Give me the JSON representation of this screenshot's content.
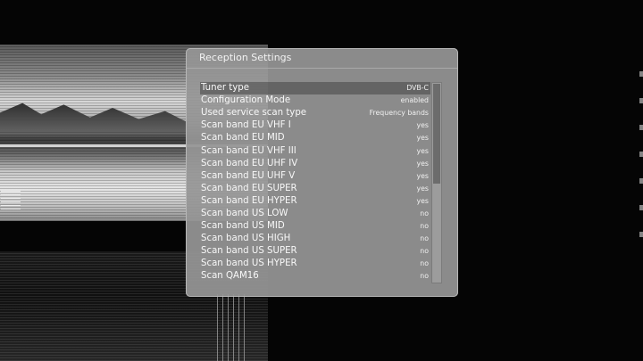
{
  "dialog": {
    "title": "Reception Settings",
    "rows": [
      {
        "label": "Tuner type",
        "value": "DVB-C",
        "selected": true
      },
      {
        "label": "Configuration Mode",
        "value": "enabled"
      },
      {
        "label": "Used service scan type",
        "value": "Frequency bands"
      },
      {
        "label": "Scan band EU VHF I",
        "value": "yes"
      },
      {
        "label": "Scan band EU MID",
        "value": "yes"
      },
      {
        "label": "Scan band EU VHF III",
        "value": "yes"
      },
      {
        "label": "Scan band EU UHF IV",
        "value": "yes"
      },
      {
        "label": "Scan band EU UHF V",
        "value": "yes"
      },
      {
        "label": "Scan band EU SUPER",
        "value": "yes"
      },
      {
        "label": "Scan band EU HYPER",
        "value": "yes"
      },
      {
        "label": "Scan band US LOW",
        "value": "no"
      },
      {
        "label": "Scan band US MID",
        "value": "no"
      },
      {
        "label": "Scan band US HIGH",
        "value": "no"
      },
      {
        "label": "Scan band US SUPER",
        "value": "no"
      },
      {
        "label": "Scan band US HYPER",
        "value": "no"
      },
      {
        "label": "Scan QAM16",
        "value": "no"
      }
    ],
    "scroll_position_fraction": 0.0,
    "scroll_visible_fraction": 0.5
  }
}
